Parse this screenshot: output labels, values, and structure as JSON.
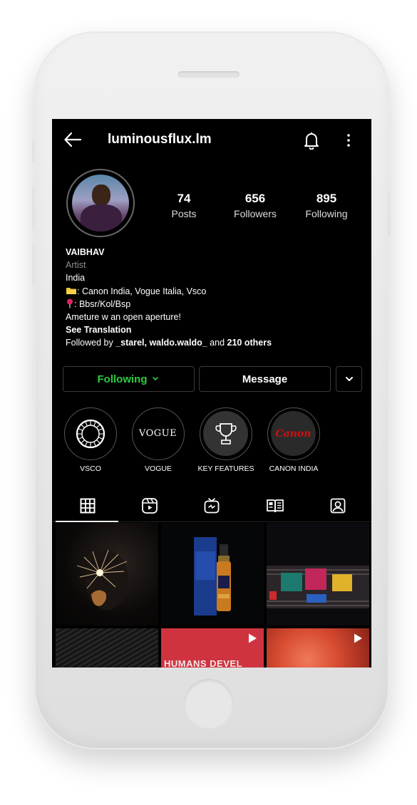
{
  "profile": {
    "username": "luminousflux.lm",
    "stats": [
      {
        "value": "74",
        "label": "Posts"
      },
      {
        "value": "656",
        "label": "Followers"
      },
      {
        "value": "895",
        "label": "Following"
      }
    ],
    "name": "VAIBHAV",
    "category": "Artist",
    "bio_lines": [
      "India",
      ": Canon India, Vogue Italia, Vsco",
      ": Bbsr/Kol/Bsp",
      "Ameture w an open aperture!"
    ],
    "see_translation": "See Translation",
    "followed_by": {
      "prefix": "Followed by ",
      "users": "_starel, waldo.waldo_",
      "middle": " and ",
      "others": "210 others"
    }
  },
  "buttons": {
    "following": "Following",
    "message": "Message"
  },
  "highlights": [
    {
      "label": "VSCO",
      "icon": "vsco-logo"
    },
    {
      "label": "VOGUE",
      "icon": "vogue-logo",
      "text": "VOGUE"
    },
    {
      "label": "KEY FEATURES",
      "icon": "trophy-icon"
    },
    {
      "label": "CANON INDIA",
      "icon": "canon-logo",
      "text": "Canon"
    }
  ],
  "tabs": [
    {
      "name": "grid",
      "icon": "grid-icon"
    },
    {
      "name": "reels",
      "icon": "reels-icon"
    },
    {
      "name": "igtv",
      "icon": "igtv-icon"
    },
    {
      "name": "guides",
      "icon": "guides-icon"
    },
    {
      "name": "tagged",
      "icon": "tagged-icon"
    }
  ],
  "grid_posts": [
    {
      "subject": "sparkler-photo"
    },
    {
      "subject": "whisky-bottle-photo"
    },
    {
      "subject": "shelf-products-photo"
    },
    {
      "subject": "dark-texture-photo"
    },
    {
      "subject": "red-video-thumbnail",
      "caption": "HUMANS DEVEL"
    },
    {
      "subject": "orange-video-thumbnail"
    }
  ],
  "colors": {
    "background": "#000000",
    "following_accent": "#2ecc40",
    "canon_red": "#d01010"
  }
}
